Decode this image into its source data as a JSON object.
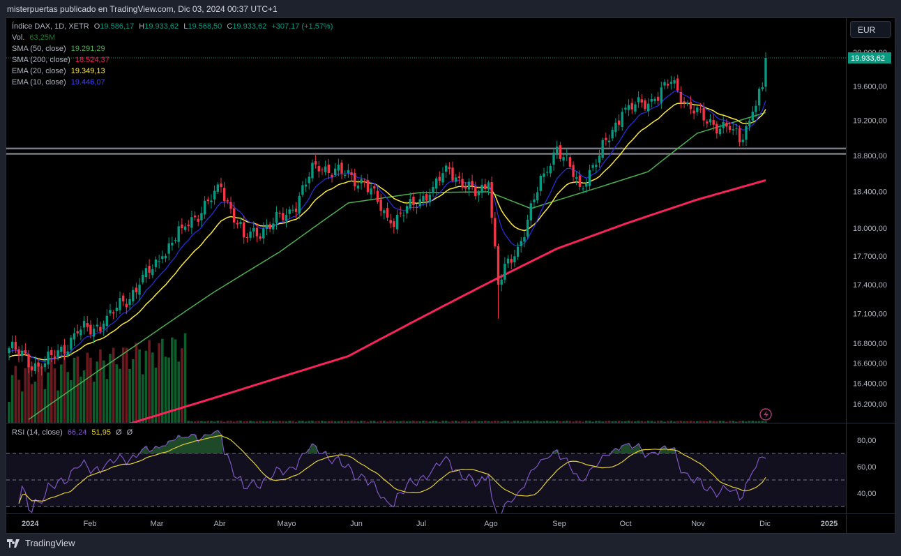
{
  "header": {
    "title": "misterpuertas publicado en TradingView.com, Dic 03, 2024 00:37 UTC+1"
  },
  "legend": {
    "symbol": "Índice DAX, 1D, XETR",
    "open_label": "O",
    "open": "19.586,17",
    "high_label": "H",
    "high": "19.933,62",
    "low_label": "L",
    "low": "19.568,50",
    "close_label": "C",
    "close": "19.933,62",
    "change": "+307,17 (+1,57%)",
    "vol_label": "Vol.",
    "vol": "63,25M",
    "sma50_label": "SMA (50, close)",
    "sma50": "19.291,29",
    "sma200_label": "SMA (200, close)",
    "sma200": "18.524,37",
    "ema20_label": "EMA (20, close)",
    "ema20": "19.349,13",
    "ema10_label": "EMA (10, close)",
    "ema10": "19.446,07"
  },
  "rsi_legend": {
    "label": "RSI (14, close)",
    "rsi": "66,24",
    "rsi_ma": "51,95",
    "na1": "Ø",
    "na2": "Ø"
  },
  "currency_button": "EUR",
  "last_price_tag": "19.933,62",
  "footer": {
    "brand": "TradingView"
  },
  "colors": {
    "up": "#089981",
    "down": "#f23645",
    "sma50": "#4caf50",
    "sma200": "#f7245a",
    "ema20": "#ffeb3b",
    "ema10": "#2a2ee6",
    "rsi": "#7e57c2",
    "rsi_ma": "#e6d22e"
  },
  "chart_data": {
    "type": "candlestick",
    "title": "Índice DAX, 1D, XETR",
    "scale": "log",
    "price_ticks": [
      "20.000,00",
      "19.600,00",
      "19.200,00",
      "18.800,00",
      "18.400,00",
      "18.000,00",
      "17.700,00",
      "17.400,00",
      "17.100,00",
      "16.800,00",
      "16.600,00",
      "16.400,00",
      "16.200,00"
    ],
    "price_tick_values": [
      20000,
      19600,
      19200,
      18800,
      18400,
      18000,
      17700,
      17400,
      17100,
      16800,
      16600,
      16400,
      16200
    ],
    "time_ticks": [
      "2024",
      "Feb",
      "Mar",
      "Abr",
      "Mayo",
      "Jun",
      "Jul",
      "Ago",
      "Sep",
      "Oct",
      "Nov",
      "Dic",
      "2025"
    ],
    "trading_days": 233,
    "close_anchors": [
      [
        0,
        16750
      ],
      [
        10,
        16550
      ],
      [
        21,
        16900
      ],
      [
        29,
        17000
      ],
      [
        40,
        17400
      ],
      [
        47,
        17700
      ],
      [
        53,
        18000
      ],
      [
        62,
        18300
      ],
      [
        65,
        18450
      ],
      [
        72,
        17900
      ],
      [
        81,
        18050
      ],
      [
        87,
        18200
      ],
      [
        94,
        18700
      ],
      [
        102,
        18600
      ],
      [
        109,
        18500
      ],
      [
        117,
        18050
      ],
      [
        124,
        18250
      ],
      [
        130,
        18450
      ],
      [
        135,
        18650
      ],
      [
        143,
        18350
      ],
      [
        147,
        18500
      ],
      [
        150,
        17400
      ],
      [
        156,
        17800
      ],
      [
        164,
        18600
      ],
      [
        168,
        18900
      ],
      [
        175,
        18450
      ],
      [
        181,
        18800
      ],
      [
        188,
        19300
      ],
      [
        198,
        19450
      ],
      [
        203,
        19650
      ],
      [
        208,
        19400
      ],
      [
        213,
        19200
      ],
      [
        222,
        19100
      ],
      [
        224,
        18950
      ],
      [
        228,
        19300
      ],
      [
        231,
        19586
      ],
      [
        232,
        19933
      ]
    ],
    "sma50_anchors": [
      [
        6,
        16050
      ],
      [
        40,
        16805
      ],
      [
        62,
        17305
      ],
      [
        83,
        17746
      ],
      [
        104,
        18273
      ],
      [
        126,
        18388
      ],
      [
        147,
        18396
      ],
      [
        160,
        18213
      ],
      [
        181,
        18447
      ],
      [
        196,
        18620
      ],
      [
        211,
        19053
      ],
      [
        232,
        19291
      ]
    ],
    "sma200_anchors": [
      [
        36,
        16000
      ],
      [
        62,
        16250
      ],
      [
        104,
        16670
      ],
      [
        147,
        17420
      ],
      [
        168,
        17780
      ],
      [
        190,
        18060
      ],
      [
        211,
        18310
      ],
      [
        232,
        18524
      ]
    ],
    "resistance_levels": [
      18880,
      18820
    ],
    "rsi": {
      "period": 14,
      "levels": [
        70,
        50,
        30
      ],
      "ticks": [
        "80,00",
        "60,00",
        "40,00"
      ],
      "tick_values": [
        80,
        60,
        40
      ],
      "last": 66.24,
      "ma_last": 51.95
    }
  }
}
